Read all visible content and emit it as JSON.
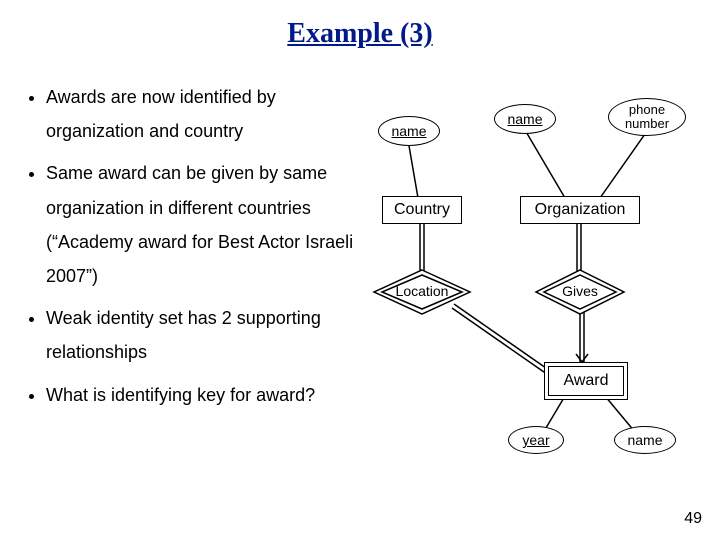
{
  "title": "Example (3)",
  "bullets": [
    "Awards are now identified by organization and country",
    "Same award can be given by same organization in different countries (“Academy award for Best Actor Israeli 2007”)",
    "Weak identity set has 2 supporting relationships",
    "What is identifying key for award?"
  ],
  "erd": {
    "country_entity": "Country",
    "organization_entity": "Organization",
    "award_entity": "Award",
    "location_rel": "Location",
    "gives_rel": "Gives",
    "country_name_attr": "name",
    "org_name_attr": "name",
    "org_phone_attr": "phone number",
    "award_year_attr": "year",
    "award_name_attr": "name"
  },
  "slide_number": "49"
}
